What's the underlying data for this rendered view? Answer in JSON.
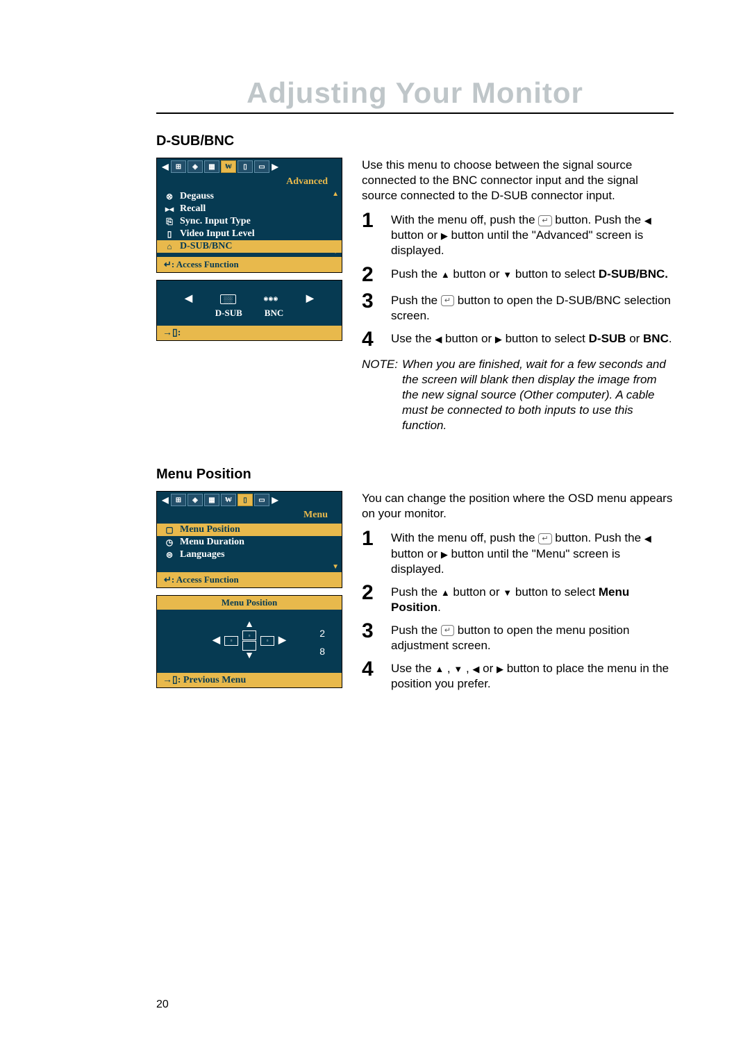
{
  "main_title": "Adjusting Your Monitor",
  "page_number": "20",
  "section1": {
    "title": "D-SUB/BNC",
    "osd": {
      "header": "Advanced",
      "items": [
        {
          "icon": "degauss-icon",
          "label": "Degauss"
        },
        {
          "icon": "recall-icon",
          "label": "Recall"
        },
        {
          "icon": "sync-icon",
          "label": "Sync. Input Type"
        },
        {
          "icon": "video-level-icon",
          "label": "Video Input Level"
        },
        {
          "icon": "dsub-bnc-icon",
          "label": "D-SUB/BNC"
        }
      ],
      "footer": ": Access Function"
    },
    "sub_osd": {
      "option_left": "D-SUB",
      "option_right": "BNC",
      "footer": ":"
    },
    "intro": "Use this menu to choose between the signal source connected to the BNC connector input and the signal source connected to the D-SUB connector input.",
    "steps": [
      {
        "n": "1",
        "pre": "With the menu off, push the ",
        "mid": " button. Push the ",
        "mid2": " button or ",
        "post": " button until the \"Advanced\" screen is displayed."
      },
      {
        "n": "2",
        "pre": "Push the ",
        "mid": " button or ",
        "post": " button to select ",
        "bold": "D-SUB/BNC."
      },
      {
        "n": "3",
        "pre": "Push the ",
        "post": " button to open the D-SUB/BNC selection screen."
      },
      {
        "n": "4",
        "pre": "Use the ",
        "mid": " button or ",
        "post": " button to select ",
        "bold1": "D-SUB",
        "or": " or ",
        "bold2": "BNC",
        "end": "."
      }
    ],
    "note_label": "NOTE:",
    "note_body": "When you are finished, wait for a few seconds and the screen will blank then display the image from the new signal source (Other computer). A cable must be connected to both inputs to use this function."
  },
  "section2": {
    "title": "Menu Position",
    "osd": {
      "header": "Menu",
      "items": [
        {
          "icon": "menu-position-icon",
          "label": "Menu Position"
        },
        {
          "icon": "menu-duration-icon",
          "label": "Menu Duration"
        },
        {
          "icon": "languages-icon",
          "label": "Languages"
        }
      ],
      "footer": ": Access Function"
    },
    "sub_osd": {
      "title": "Menu Position",
      "value1": "2",
      "value2": "8",
      "footer": ": Previous Menu"
    },
    "intro": "You can change the position where the OSD menu appears on your monitor.",
    "steps": [
      {
        "n": "1",
        "pre": "With the menu off, push the ",
        "mid": " button. Push the ",
        "mid2": " button or ",
        "post": " button until the \"Menu\" screen is displayed."
      },
      {
        "n": "2",
        "pre": "Push the ",
        "mid": " button or ",
        "post": " button to select ",
        "bold": "Menu Position",
        "end": "."
      },
      {
        "n": "3",
        "pre": "Push the ",
        "post": " button to open the menu position adjustment screen."
      },
      {
        "n": "4",
        "pre": "Use the ",
        "post": " button to place the menu in the position you prefer."
      }
    ]
  }
}
